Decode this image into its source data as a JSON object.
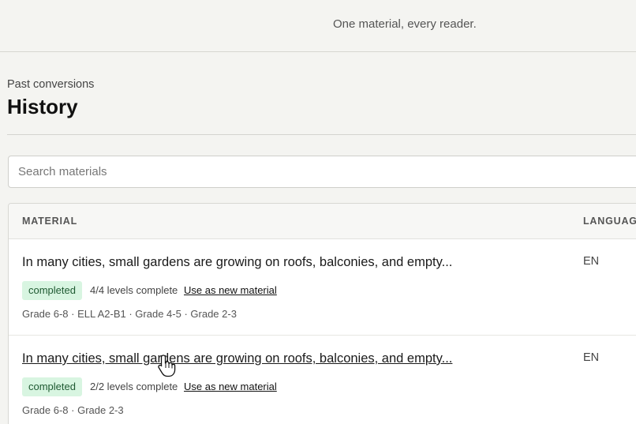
{
  "header": {
    "tagline": "One material, every reader."
  },
  "page": {
    "eyebrow": "Past conversions",
    "title": "History"
  },
  "search": {
    "placeholder": "Search materials",
    "value": ""
  },
  "table": {
    "columns": {
      "material": "MATERIAL",
      "language": "LANGUAG"
    },
    "rows": [
      {
        "title": "In many cities, small gardens are growing on roofs, balconies, and empty...",
        "language": "EN",
        "status": "completed",
        "levels": "4/4 levels complete",
        "action": "Use as new material",
        "grades": "Grade 6-8 · ELL A2-B1 · Grade 4-5 · Grade 2-3"
      },
      {
        "title": "In many cities, small gardens are growing on roofs, balconies, and empty...",
        "language": "EN",
        "status": "completed",
        "levels": "2/2 levels complete",
        "action": "Use as new material",
        "grades": "Grade 6-8 · Grade 2-3"
      }
    ]
  },
  "icons": {
    "cursor": "hand-pointer-icon"
  },
  "colors": {
    "background": "#f4f4f1",
    "badge_bg": "#d8f5e1",
    "badge_text": "#1f5a32"
  }
}
